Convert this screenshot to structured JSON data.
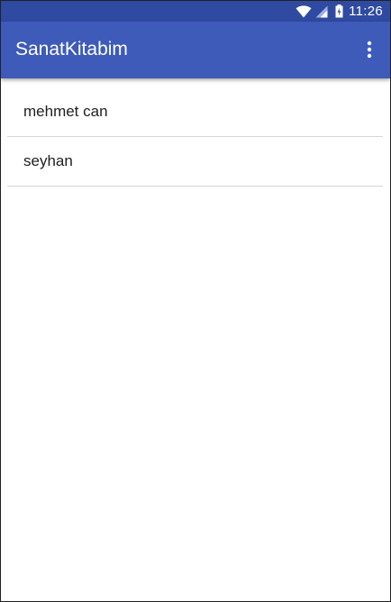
{
  "status_bar": {
    "time": "11:26",
    "icons": [
      "wifi-icon",
      "cell-signal-icon",
      "battery-charging-icon"
    ]
  },
  "app_bar": {
    "title": "SanatKitabim",
    "overflow_icon": "more-vert-icon"
  },
  "list": {
    "items": [
      {
        "label": "mehmet can"
      },
      {
        "label": "seyhan"
      }
    ]
  },
  "colors": {
    "status_bar": "#2f4aa1",
    "app_bar": "#3e5bba",
    "divider": "#d6d6d6",
    "text": "#212121"
  }
}
